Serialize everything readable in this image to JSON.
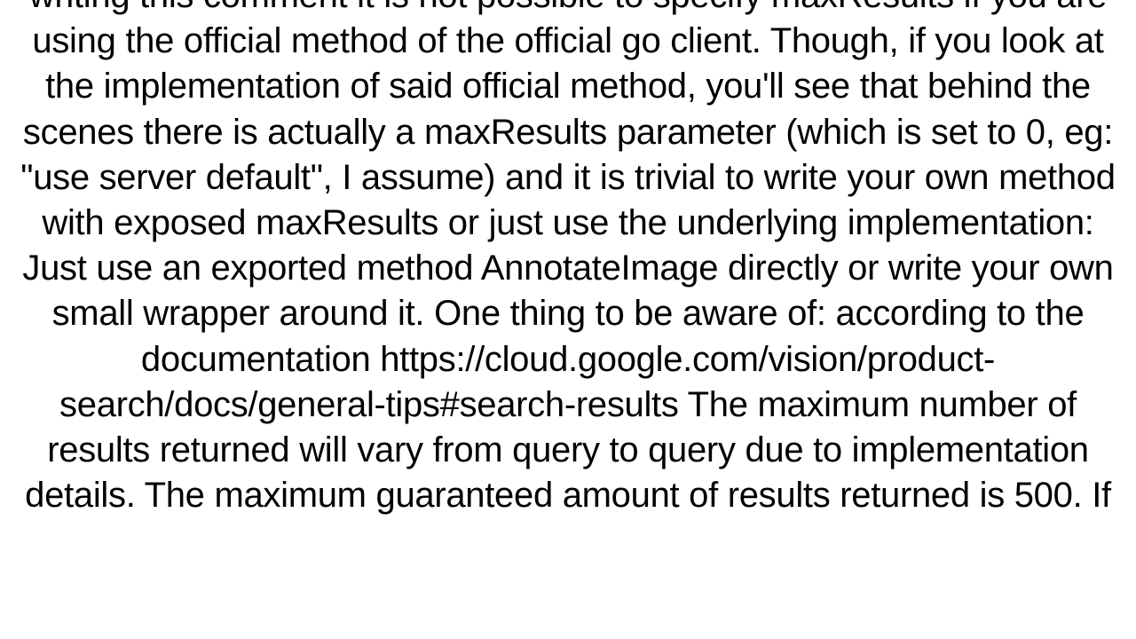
{
  "document": {
    "body_text": "writing this comment it is not possible to specify maxResults if you are using the official method of the official go client. Though, if you look at the implementation of said official method, you'll see that behind the scenes there is actually a maxResults parameter (which is set to 0, eg: \"use server default\", I assume) and it is trivial to write your own method with exposed maxResults or just use the underlying implementation:   Just use an exported method AnnotateImage directly or write your own small wrapper around it. One thing to be aware of: according to the documentation https://cloud.google.com/vision/product-search/docs/general-tips#search-results  The maximum number of results returned will vary from query to query due to implementation details. The maximum guaranteed amount of results returned is 500. If"
  }
}
